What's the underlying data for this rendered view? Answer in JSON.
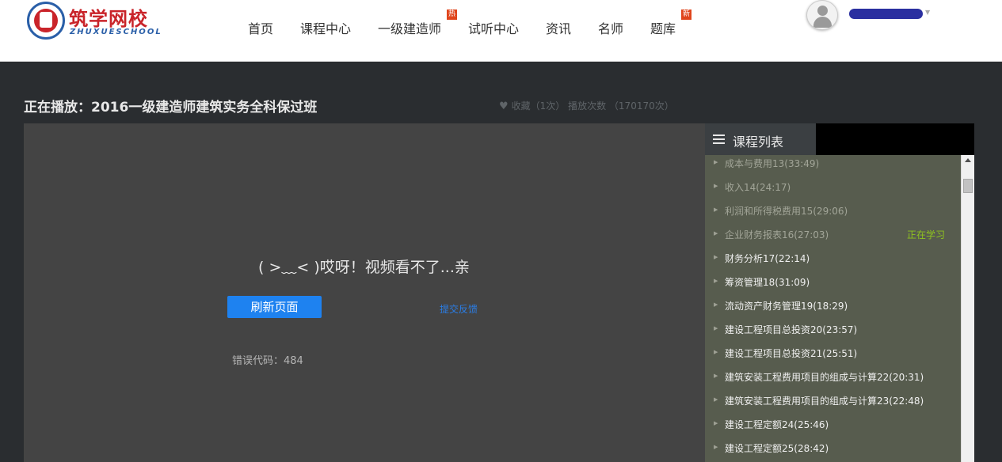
{
  "header": {
    "logo_title": "筑学网校",
    "logo_sub": "ZHUXUESCHOOL",
    "nav": [
      {
        "label": "首页",
        "badge": ""
      },
      {
        "label": "课程中心",
        "badge": ""
      },
      {
        "label": "一级建造师",
        "badge": "热"
      },
      {
        "label": "试听中心",
        "badge": ""
      },
      {
        "label": "资讯",
        "badge": ""
      },
      {
        "label": "名师",
        "badge": ""
      },
      {
        "label": "题库",
        "badge": "新"
      }
    ]
  },
  "player": {
    "title": "正在播放：2016一级建造师建筑实务全科保过班",
    "stats": "收藏（1次） 播放次数 （170170次）",
    "error_message": "( >﹏< )哎呀！视频看不了...亲",
    "refresh_label": "刷新页面",
    "feedback_label": "提交反馈",
    "error_code": "错误代码：484"
  },
  "course_list": {
    "title": "课程列表",
    "items": [
      {
        "label": "成本与费用13(33:49)",
        "state": "done",
        "status": ""
      },
      {
        "label": "收入14(24:17)",
        "state": "done",
        "status": ""
      },
      {
        "label": "利润和所得税费用15(29:06)",
        "state": "done",
        "status": ""
      },
      {
        "label": "企业财务报表16(27:03)",
        "state": "done",
        "status": "正在学习"
      },
      {
        "label": "财务分析17(22:14)",
        "state": "todo",
        "status": ""
      },
      {
        "label": "筹资管理18(31:09)",
        "state": "todo",
        "status": ""
      },
      {
        "label": "流动资产财务管理19(18:29)",
        "state": "todo",
        "status": ""
      },
      {
        "label": "建设工程项目总投资20(23:57)",
        "state": "todo",
        "status": ""
      },
      {
        "label": "建设工程项目总投资21(25:51)",
        "state": "todo",
        "status": ""
      },
      {
        "label": "建筑安装工程费用项目的组成与计算22(20:31)",
        "state": "todo",
        "status": ""
      },
      {
        "label": "建筑安装工程费用项目的组成与计算23(22:48)",
        "state": "todo",
        "status": ""
      },
      {
        "label": "建设工程定额24(25:46)",
        "state": "todo",
        "status": ""
      },
      {
        "label": "建设工程定额25(28:42)",
        "state": "todo",
        "status": ""
      }
    ]
  },
  "colors": {
    "brand_red": "#c9242a",
    "brand_blue": "#2a5fa8",
    "button_blue": "#1e82f0",
    "learning_green": "#8fc31f"
  }
}
